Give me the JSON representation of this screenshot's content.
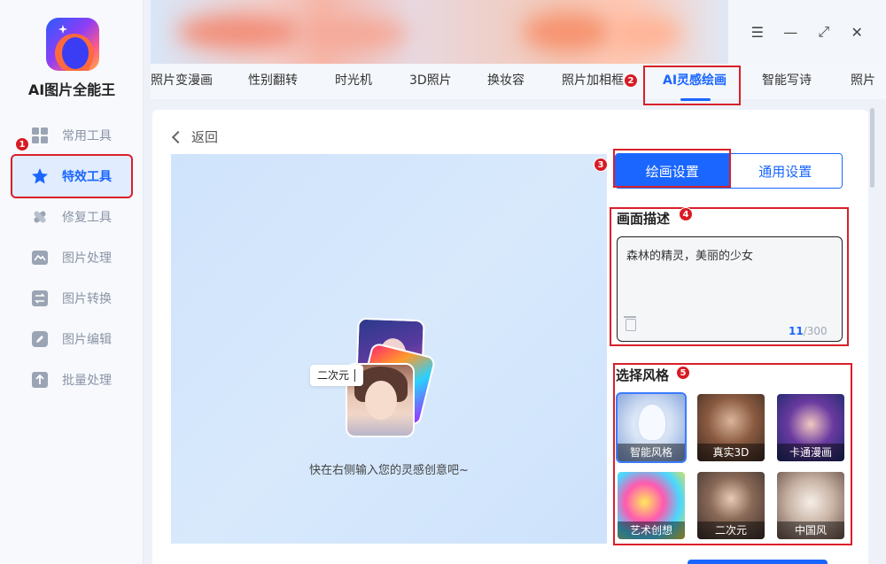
{
  "app": {
    "name": "AI图片全能王"
  },
  "sidebar": {
    "items": [
      {
        "label": "常用工具",
        "icon": "grid-icon"
      },
      {
        "label": "特效工具",
        "icon": "star-icon",
        "active": true
      },
      {
        "label": "修复工具",
        "icon": "bandage-icon"
      },
      {
        "label": "图片处理",
        "icon": "image-icon"
      },
      {
        "label": "图片转换",
        "icon": "convert-icon"
      },
      {
        "label": "图片编辑",
        "icon": "edit-icon"
      },
      {
        "label": "批量处理",
        "icon": "upload-icon"
      }
    ]
  },
  "window": {
    "menu": "☰",
    "minimize": "—",
    "maximize": "⤢",
    "close": "✕"
  },
  "tabs": [
    "照片变漫画",
    "性别翻转",
    "时光机",
    "3D照片",
    "换妆容",
    "照片加相框",
    "AI灵感绘画",
    "智能写诗",
    "照片"
  ],
  "active_tab": "AI灵感绘画",
  "badges": [
    "1",
    "2",
    "3",
    "4",
    "5"
  ],
  "back_label": "返回",
  "preview": {
    "chip_text": "二次元",
    "hint": "快在右侧输入您的灵感创意吧~"
  },
  "settings": {
    "tab_draw": "绘画设置",
    "tab_general": "通用设置",
    "desc_title": "画面描述",
    "desc_value": "森林的精灵，美丽的少女",
    "count_current": "11",
    "count_max": "/300",
    "style_title": "选择风格",
    "styles": [
      "智能风格",
      "真实3D",
      "卡通漫画",
      "艺术创想",
      "二次元",
      "中国风"
    ]
  },
  "colors": {
    "accent": "#1a66ff",
    "highlight": "#d9202a"
  }
}
